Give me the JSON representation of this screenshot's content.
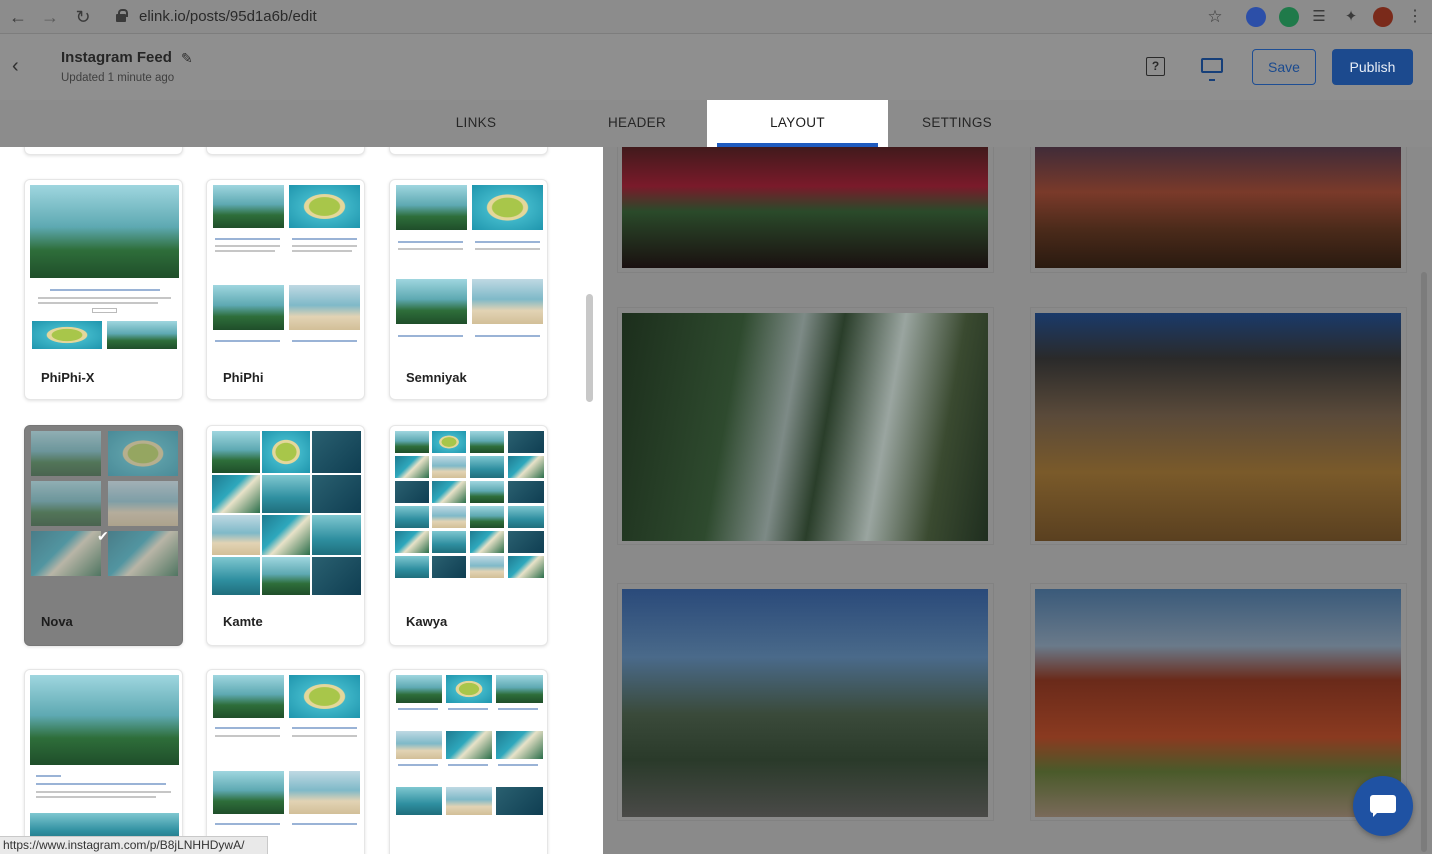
{
  "browser": {
    "url": "elink.io/posts/95d1a6b/edit",
    "status_url": "https://www.instagram.com/p/B8jLNHHDywA/"
  },
  "header": {
    "title": "Instagram Feed",
    "updated": "Updated 1 minute ago",
    "save_label": "Save",
    "publish_label": "Publish",
    "help_label": "?"
  },
  "tabs": [
    {
      "label": "LINKS",
      "active": false
    },
    {
      "label": "HEADER",
      "active": false
    },
    {
      "label": "LAYOUT",
      "active": true
    },
    {
      "label": "SETTINGS",
      "active": false
    }
  ],
  "layouts": {
    "row1": [
      {
        "label": "PhiPhi-X"
      },
      {
        "label": "PhiPhi"
      },
      {
        "label": "Semniyak"
      }
    ],
    "row2": [
      {
        "label": "Nova",
        "selected": true
      },
      {
        "label": "Kamte"
      },
      {
        "label": "Kawya"
      }
    ]
  },
  "colors": {
    "accent": "#1f5bbf",
    "publish_bg": "#1c4a8e"
  }
}
